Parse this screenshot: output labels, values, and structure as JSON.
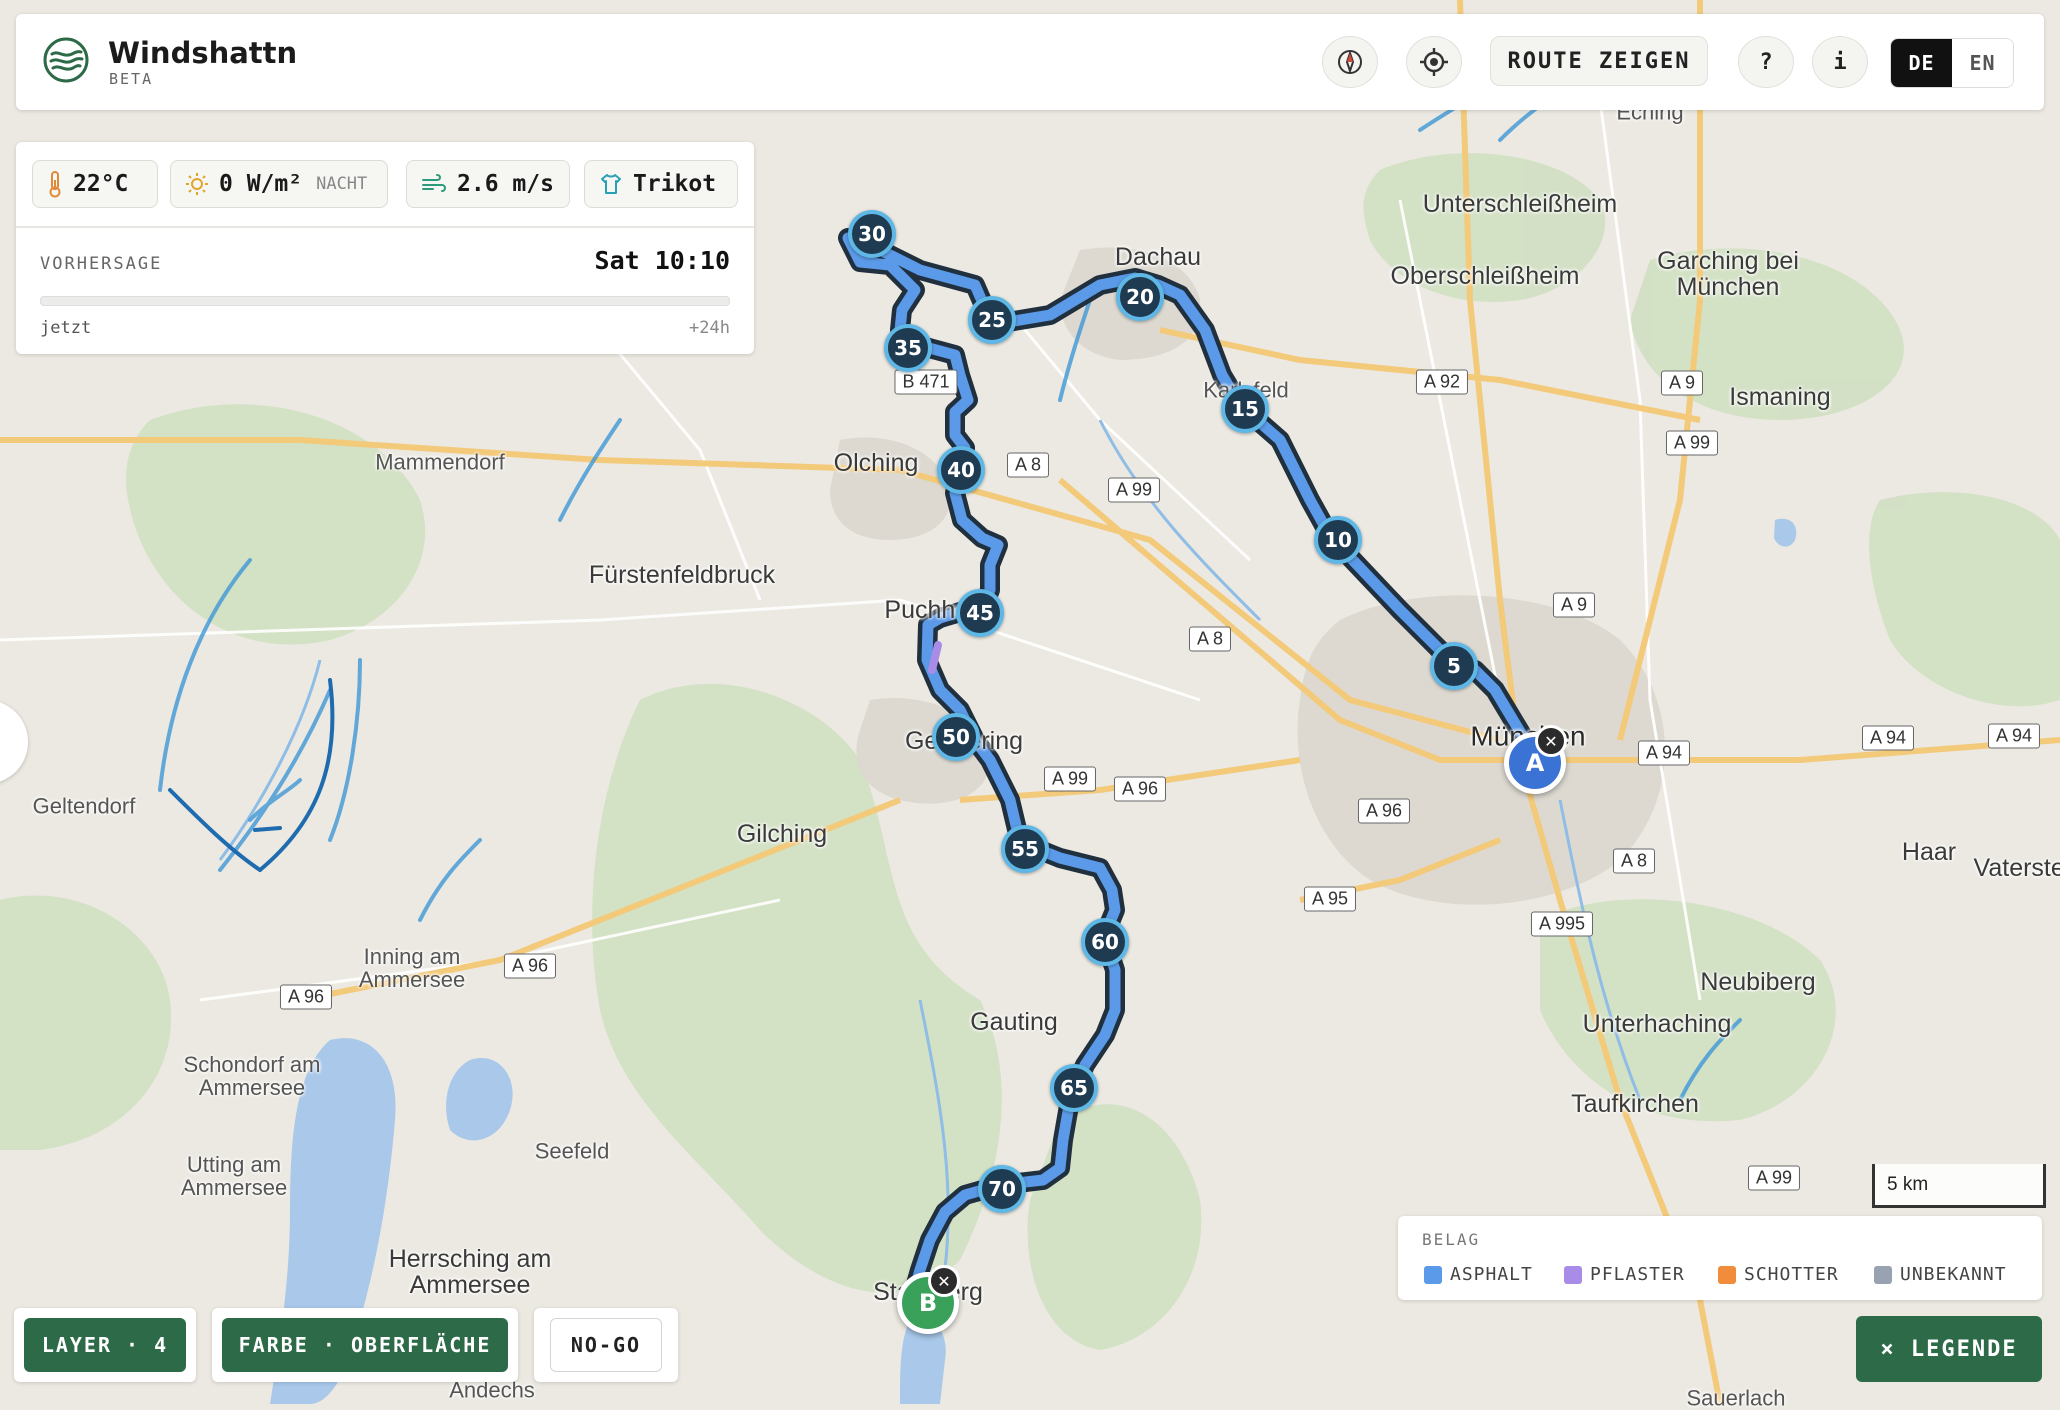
{
  "app": {
    "name": "Windshattn",
    "badge": "BETA"
  },
  "header": {
    "compass_icon": "compass-icon",
    "locate_icon": "crosshair-icon",
    "route_button": "ROUTE ZEIGEN",
    "help_button": "?",
    "info_button": "i",
    "languages": [
      "DE",
      "EN"
    ],
    "active_language": "DE"
  },
  "weather": {
    "temperature": "22°C",
    "radiation": "0 W/m²",
    "radiation_note": "NACHT",
    "wind": "2.6 m/s",
    "clothing": "Trikot",
    "forecast_label": "VORHERSAGE",
    "forecast_time": "Sat 10:10",
    "slider_start": "jetzt",
    "slider_end": "+24h",
    "slider_position": 0.0
  },
  "map": {
    "places": {
      "unterschleissheim": "Unterschleißheim",
      "oberschleissheim": "Oberschleißheim",
      "garching": "Garching bei\nMünchen",
      "ismaning": "Ismaning",
      "dachau": "Dachau",
      "karlsfeld": "Karlsfeld",
      "mammendorf": "Mammendorf",
      "olching": "Olching",
      "fuerstenfeldbruck": "Fürstenfeldbruck",
      "puchheim": "Puchheim",
      "germering": "Germering",
      "gilching": "Gilching",
      "geltendorf": "Geltendorf",
      "muenchen": "München",
      "haar": "Haar",
      "vaterstetten": "Vaterstetten",
      "neubiberg": "Neubiberg",
      "unterhaching": "Unterhaching",
      "taufkirchen": "Taufkirchen",
      "gauting": "Gauting",
      "inning": "Inning am\nAmmersee",
      "schondorf": "Schondorf am\nAmmersee",
      "utting": "Utting am\nAmmersee",
      "seefeld": "Seefeld",
      "herrsching": "Herrsching am\nAmmersee",
      "starnberg": "Starnberg",
      "andechs": "Andechs",
      "sauerlach": "Sauerlach",
      "eching": "Eching"
    },
    "roads": {
      "b471": "B 471",
      "a8_1": "A 8",
      "a99_1": "A 99",
      "a92": "A 92",
      "a9_1": "A 9",
      "a99_2": "A 99",
      "a9_2": "A 9",
      "a8_2": "A 8",
      "a99_3": "A 99",
      "a96_1": "A 96",
      "a96_2": "A 96",
      "a94_1": "A 94",
      "a94_2": "A 94",
      "a94_3": "A 94",
      "a8_3": "A 8",
      "a95": "A 95",
      "a995": "A 995",
      "a96_3": "A 96",
      "a96_4": "A 96",
      "a99_4": "A 99"
    },
    "km_markers": [
      "5",
      "10",
      "15",
      "20",
      "25",
      "30",
      "35",
      "40",
      "45",
      "50",
      "55",
      "60",
      "65",
      "70"
    ],
    "start_label": "A",
    "end_label": "B",
    "scale": "5 km"
  },
  "controls": {
    "layer": "LAYER · 4",
    "color": "FARBE · OBERFLÄCHE",
    "nogo": "NO-GO",
    "legend_toggle": "× LEGENDE"
  },
  "legend": {
    "title": "BELAG",
    "items": [
      {
        "label": "ASPHALT",
        "color": "#5b9ae8"
      },
      {
        "label": "PFLASTER",
        "color": "#a98be8"
      },
      {
        "label": "SCHOTTER",
        "color": "#f08c3a"
      },
      {
        "label": "UNBEKANNT",
        "color": "#98a2b0"
      }
    ]
  },
  "colors": {
    "accent": "#2c6a48",
    "route": "#5b9ae8",
    "route_outline": "#20303f"
  }
}
